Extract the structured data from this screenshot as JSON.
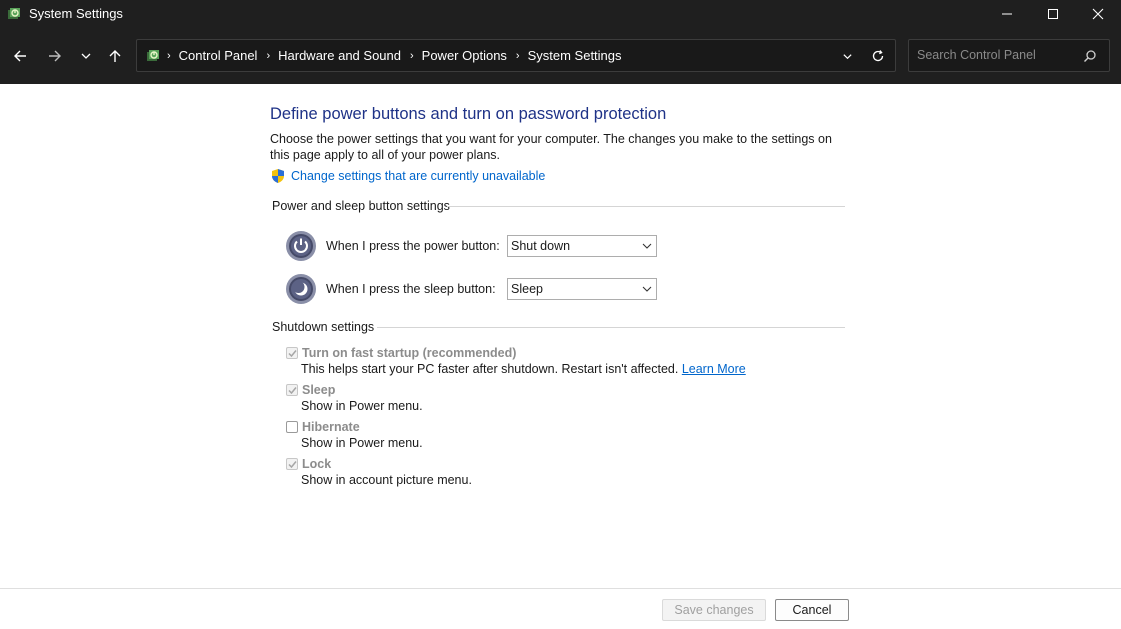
{
  "window": {
    "title": "System Settings",
    "app_icon": "control-panel-power-icon",
    "controls": [
      "minimize-icon",
      "maximize-icon",
      "close-icon"
    ]
  },
  "nav": {
    "buttons": [
      "back-arrow-icon",
      "forward-arrow-icon",
      "chevron-down-icon",
      "up-arrow-icon"
    ],
    "breadcrumb": [
      "Control Panel",
      "Hardware and Sound",
      "Power Options",
      "System Settings"
    ],
    "search_placeholder": "Search Control Panel"
  },
  "main": {
    "title": "Define power buttons and turn on password protection",
    "intro": "Choose the power settings that you want for your computer. The changes you make to the settings on this page apply to all of your power plans.",
    "change_link": "Change settings that are currently unavailable",
    "power_group": {
      "heading": "Power and sleep button settings",
      "rows": [
        {
          "label": "When I press the power button:",
          "value": "Shut down",
          "icon": "power-button-icon"
        },
        {
          "label": "When I press the sleep button:",
          "value": "Sleep",
          "icon": "sleep-button-icon"
        }
      ]
    },
    "shutdown_group": {
      "heading": "Shutdown settings",
      "items": [
        {
          "label": "Turn on fast startup (recommended)",
          "desc": "This helps start your PC faster after shutdown. Restart isn't affected.",
          "link": "Learn More",
          "checked": true,
          "disabled": true
        },
        {
          "label": "Sleep",
          "desc": "Show in Power menu.",
          "checked": true,
          "disabled": true
        },
        {
          "label": "Hibernate",
          "desc": "Show in Power menu.",
          "checked": false,
          "disabled": true
        },
        {
          "label": "Lock",
          "desc": "Show in account picture menu.",
          "checked": true,
          "disabled": true
        }
      ]
    }
  },
  "footer": {
    "save_label": "Save changes",
    "cancel_label": "Cancel"
  },
  "colors": {
    "titlebar_bg": "#1f1f1f",
    "heading_blue": "#1e3287",
    "link_blue": "#0066cc",
    "disabled_text": "#8c8c8c"
  }
}
